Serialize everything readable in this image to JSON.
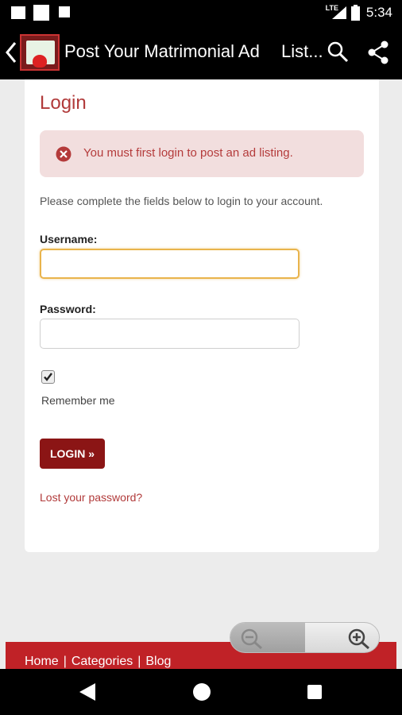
{
  "status_bar": {
    "time": "5:34",
    "network": "LTE"
  },
  "app_bar": {
    "title": "Post Your Matrimonial Ad",
    "subtitle": "List..."
  },
  "login": {
    "heading": "Login",
    "alert_message": "You must first login to post an ad listing.",
    "instructions": "Please complete the fields below to login to your account.",
    "username_label": "Username:",
    "username_value": "",
    "password_label": "Password:",
    "password_value": "",
    "remember_checked": true,
    "remember_label": "Remember me",
    "login_button": "LOGIN »",
    "lost_password_link": "Lost your password?"
  },
  "footer": {
    "links": [
      "Home",
      "Categories",
      "Blog"
    ]
  },
  "colors": {
    "accent": "#8b1515",
    "heading": "#b13a3a",
    "alert_bg": "#f2dede",
    "footer_bg": "#c02227",
    "input_focus": "#e9b44c"
  },
  "icons": {
    "back": "chevron-left-icon",
    "search": "search-icon",
    "share": "share-icon",
    "alert": "error-circle-icon",
    "zoom_out": "zoom-out-icon",
    "zoom_in": "zoom-in-icon"
  }
}
